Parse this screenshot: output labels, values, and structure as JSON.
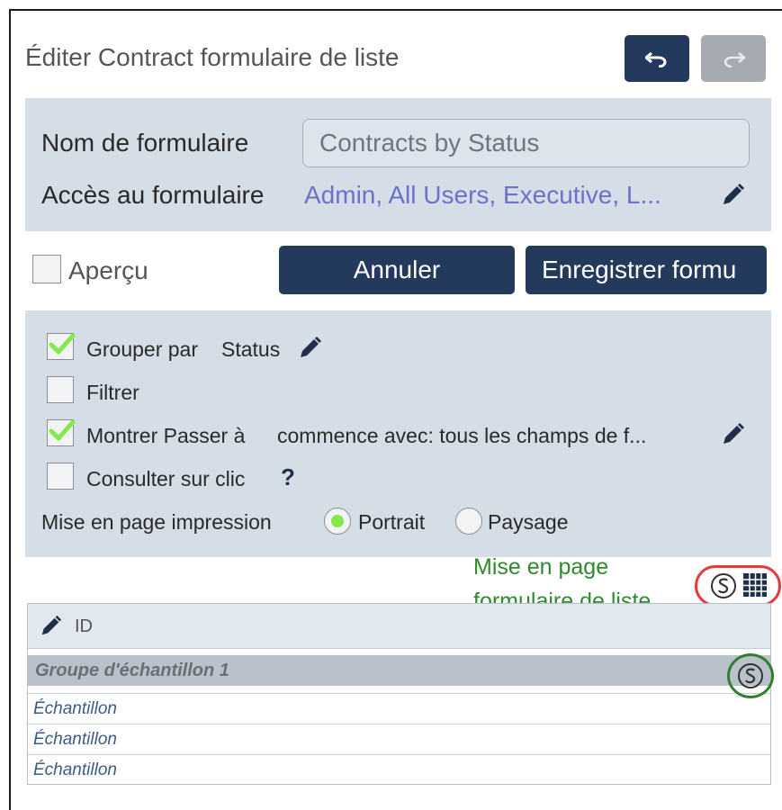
{
  "header": {
    "title": "Éditer Contract formulaire de liste"
  },
  "form": {
    "name_label": "Nom de formulaire",
    "name_value": "Contracts by Status",
    "access_label": "Accès au formulaire",
    "access_value": "Admin, All Users, Executive, L..."
  },
  "actions": {
    "preview_label": "Aperçu",
    "cancel_label": "Annuler",
    "save_label": "Enregistrer formu"
  },
  "options": {
    "group_by_label": "Grouper par",
    "group_by_value": "Status",
    "filter_label": "Filtrer",
    "show_jump_label": "Montrer Passer à",
    "show_jump_value": "commence avec: tous les champs de f...",
    "view_on_click_label": "Consulter sur clic",
    "help_glyph": "?",
    "print_layout_label": "Mise en page impression",
    "portrait_label": "Portrait",
    "landscape_label": "Paysage"
  },
  "annotation": {
    "line1": "Mise en page",
    "line2": "formulaire de liste"
  },
  "table": {
    "header_label": "ID",
    "group_label": "Groupe d'échantillon 1",
    "rows": [
      "Échantillon",
      "Échantillon",
      "Échantillon"
    ]
  },
  "colors": {
    "navy": "#233a5c",
    "panel": "#d5dde7",
    "link": "#6b72c9",
    "check_green": "#86e84a",
    "annotation_green": "#2f8a2f",
    "highlight_red": "#e63a3a"
  }
}
